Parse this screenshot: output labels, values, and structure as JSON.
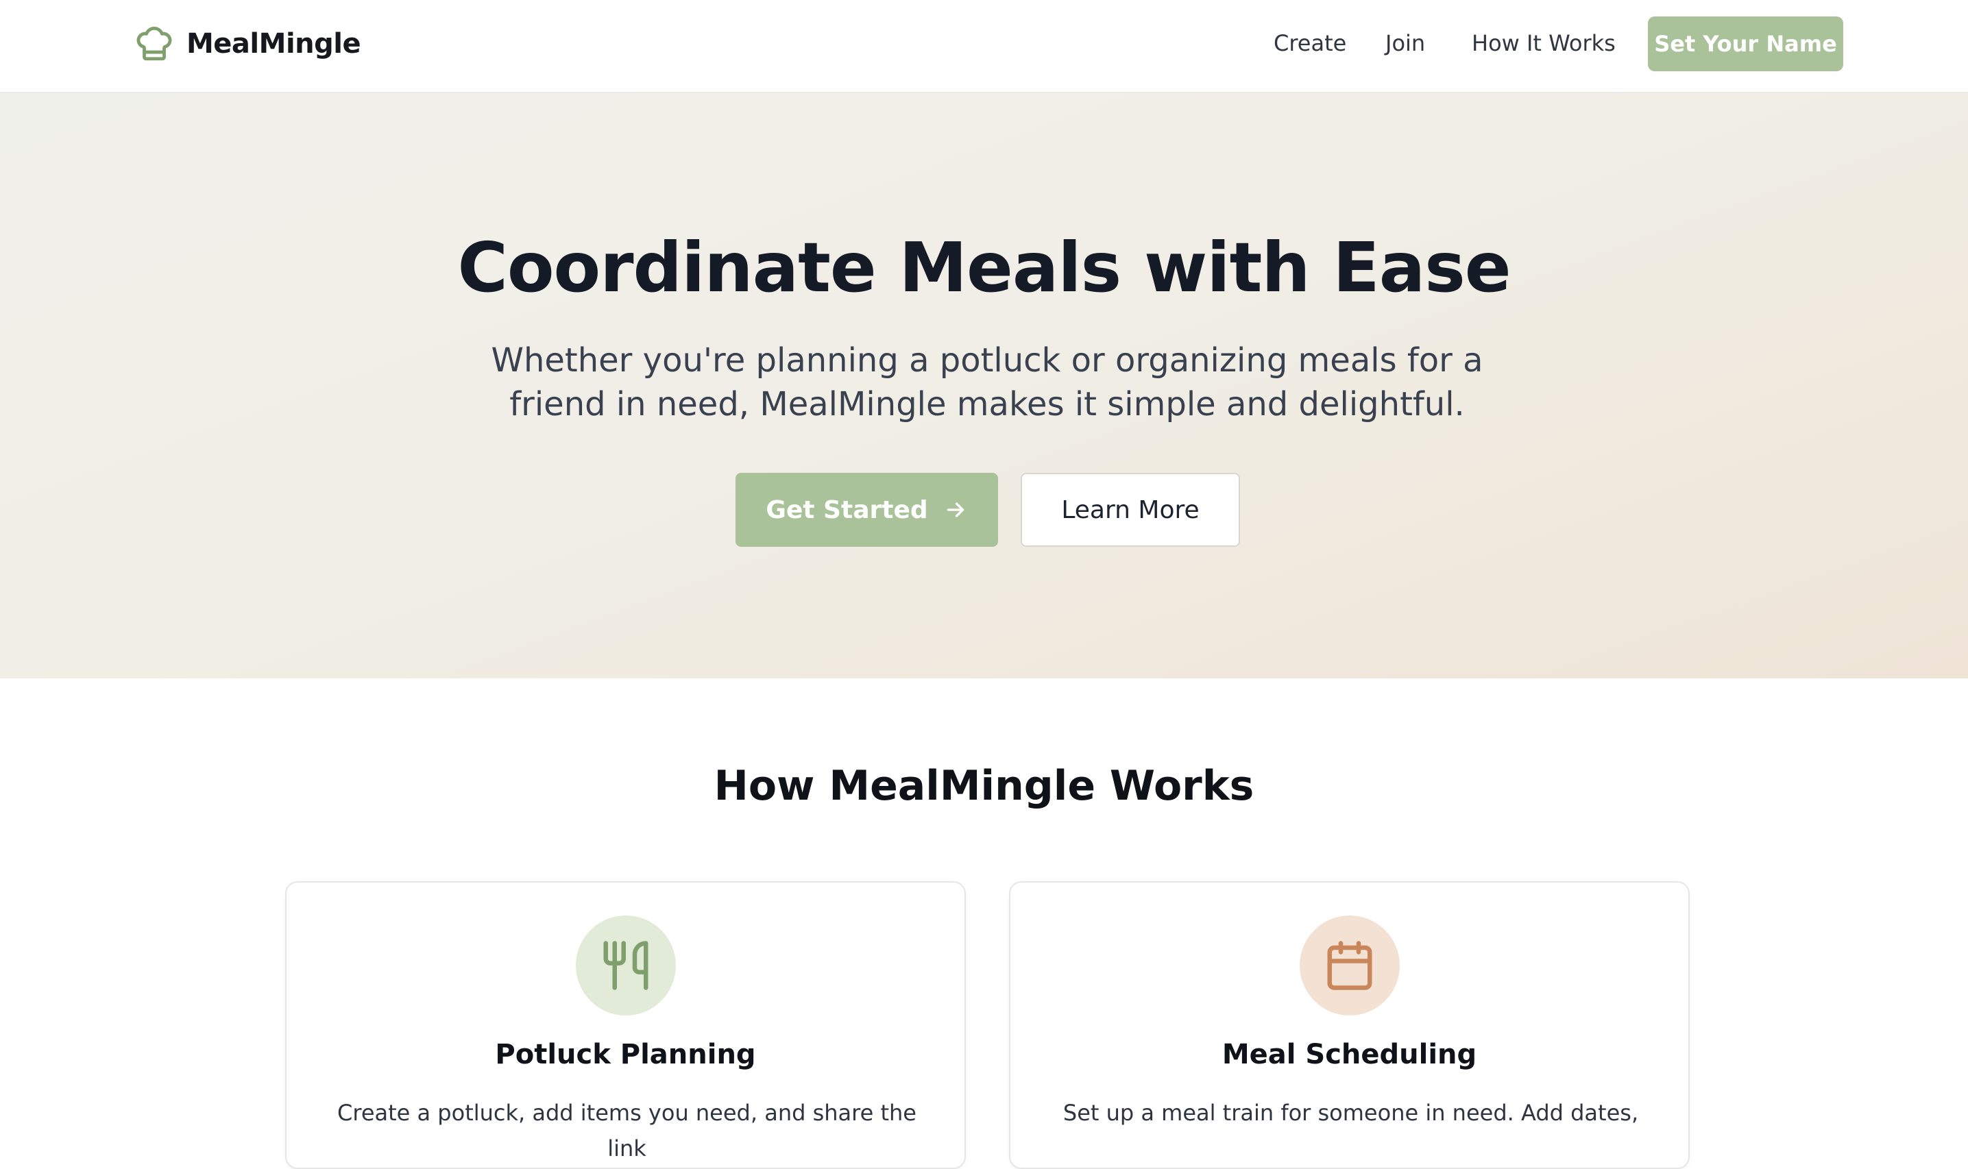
{
  "header": {
    "brand": "MealMingle",
    "nav": [
      "Create",
      "Join",
      "How It Works"
    ],
    "cta": "Set Your Name"
  },
  "hero": {
    "title": "Coordinate Meals with Ease",
    "subtitle": "Whether you're planning a potluck or organizing meals for a friend in need, MealMingle makes it simple and delightful.",
    "primary_button": "Get Started",
    "secondary_button": "Learn More"
  },
  "how_it_works": {
    "title": "How MealMingle Works",
    "cards": [
      {
        "icon": "utensils-icon",
        "title": "Potluck Planning",
        "description": "Create a potluck, add items you need, and share the link"
      },
      {
        "icon": "calendar-icon",
        "title": "Meal Scheduling",
        "description": "Set up a meal train for someone in need. Add dates,"
      }
    ]
  },
  "colors": {
    "accent": "#a9c29a",
    "accent_dark": "#7fa06c",
    "warm_accent": "#c9865a",
    "hero_bg": "#f0ede4",
    "text": "#141a26"
  }
}
